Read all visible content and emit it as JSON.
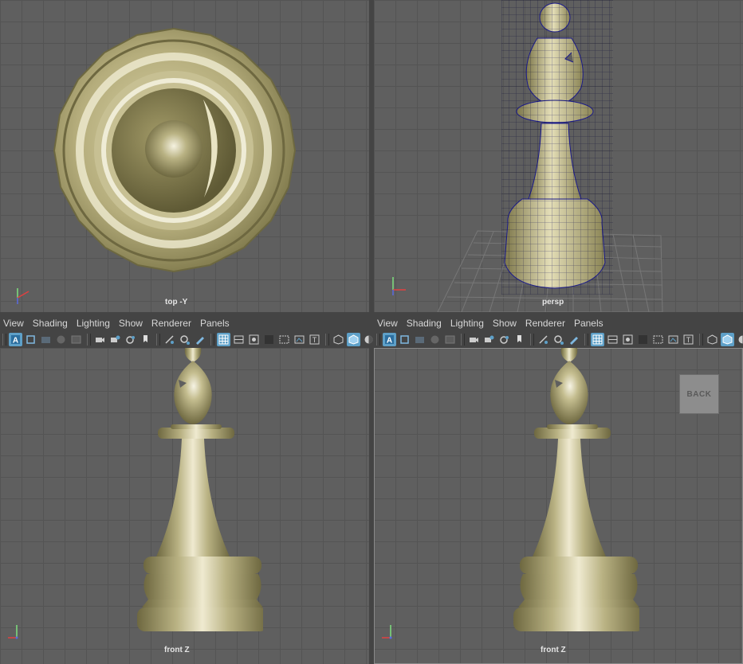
{
  "viewports": {
    "top_left": {
      "label": "top -Y"
    },
    "top_right": {
      "label": "persp"
    },
    "bottom_left": {
      "label": "front Z"
    },
    "bottom_right": {
      "label": "front Z"
    }
  },
  "menu": {
    "view": "View",
    "shading": "Shading",
    "lighting": "Lighting",
    "show": "Show",
    "renderer": "Renderer",
    "panels": "Panels"
  },
  "axes": {
    "x": "x",
    "y": "y",
    "z": "z"
  },
  "back_button": "BACK",
  "colors": {
    "model_fill": "#b8b184",
    "model_highlight": "#f2efdc",
    "model_shadow": "#6e6840",
    "wire": "#1a1a8c",
    "grid_bg": "#5f5f5f",
    "active_button": "#5ea0c8"
  },
  "toolbar_icons": [
    "select-camera-icon",
    "camera-attributes-icon",
    "bookmarks-icon",
    "image-plane-icon",
    "grid-icon-2",
    "camera-icon",
    "camera-lock-icon",
    "xray-icon",
    "pin-icon",
    "film-gate-icon",
    "pan-zoom-icon",
    "grease-pencil-icon",
    "grid-icon",
    "field-chart-icon",
    "safe-action-icon",
    "resolution-gate-icon",
    "gate-mask-icon",
    "title-safe-icon",
    "wireframe-icon",
    "smooth-shade-icon",
    "shadows-icon"
  ]
}
